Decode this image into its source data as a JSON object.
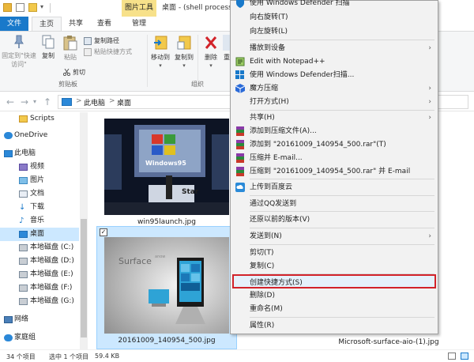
{
  "title": {
    "tools_tab": "图片工具",
    "window_title": "桌面 - (shell processi"
  },
  "tabs": [
    "文件",
    "主页",
    "共享",
    "查看",
    "管理"
  ],
  "ribbon": {
    "pin_label": "固定到\"快速访问\"",
    "copy_label": "复制",
    "paste_label": "粘贴",
    "copy_path": "复制路径",
    "paste_shortcut": "粘贴快捷方式",
    "cut": "剪切",
    "clipboard_group": "剪贴板",
    "move_to": "移动到",
    "copy_to": "复制到",
    "delete": "删除",
    "rename": "重",
    "organize_group": "组织"
  },
  "address": {
    "crumb_pc": "此电脑",
    "crumb_desktop": "桌面",
    "sep": ">"
  },
  "nav": {
    "items": [
      "Scripts",
      "OneDrive",
      "此电脑",
      "视频",
      "图片",
      "文档",
      "下载",
      "音乐",
      "桌面",
      "本地磁盘 (C:)",
      "本地磁盘 (D:)",
      "本地磁盘 (E:)",
      "本地磁盘 (F:)",
      "本地磁盘 (G:)",
      "网络",
      "家庭组"
    ]
  },
  "content": {
    "file1": "win95launch.jpg",
    "file2": "20161009_140954_500.jpg",
    "file3": "Microsoft-surface-aio-(1).jpg",
    "surface_text": "Surface",
    "surface_small": "anow",
    "win95_text": "Windows95",
    "stage_text": "Star",
    "check_mark": "✓"
  },
  "status": {
    "count": "34 个项目",
    "selected": "选中 1 个项目",
    "size": "59.4 KB"
  },
  "context_menu": {
    "items": [
      {
        "label": "使用 Windows Defender 扫描",
        "icon": "defender-icon"
      },
      {
        "label": "向右旋转(T)"
      },
      {
        "label": "向左旋转(L)"
      },
      {
        "label": "播放到设备",
        "submenu": "›"
      },
      {
        "label": "Edit with Notepad++",
        "icon": "notepad-icon"
      },
      {
        "label": "使用 Windows Defender扫描...",
        "icon": "defender-icon"
      },
      {
        "label": "魔方压缩",
        "icon": "cube-icon",
        "submenu": "›"
      },
      {
        "label": "打开方式(H)",
        "submenu": "›"
      },
      {
        "label": "共享(H)",
        "submenu": "›"
      },
      {
        "label": "添加到压缩文件(A)...",
        "icon": "winrar-icon"
      },
      {
        "label": "添加到 \"20161009_140954_500.rar\"(T)",
        "icon": "winrar-icon"
      },
      {
        "label": "压缩并 E-mail...",
        "icon": "winrar-icon"
      },
      {
        "label": "压缩到 \"20161009_140954_500.rar\" 并 E-mail",
        "icon": "winrar-icon"
      },
      {
        "label": "上传到百度云",
        "icon": "baidu-cloud-icon"
      },
      {
        "label": "通过QQ发送到"
      },
      {
        "label": "还原以前的版本(V)"
      },
      {
        "label": "发送到(N)",
        "submenu": "›"
      },
      {
        "label": "剪切(T)"
      },
      {
        "label": "复制(C)"
      },
      {
        "label": "创建快捷方式(S)"
      },
      {
        "label": "删除(D)"
      },
      {
        "label": "重命名(M)"
      },
      {
        "label": "属性(R)"
      }
    ]
  },
  "colors": {
    "accent": "#1979ca",
    "highlight_border": "#d2232a",
    "selection": "#cce8ff",
    "tools_tab": "#f7e18a"
  }
}
